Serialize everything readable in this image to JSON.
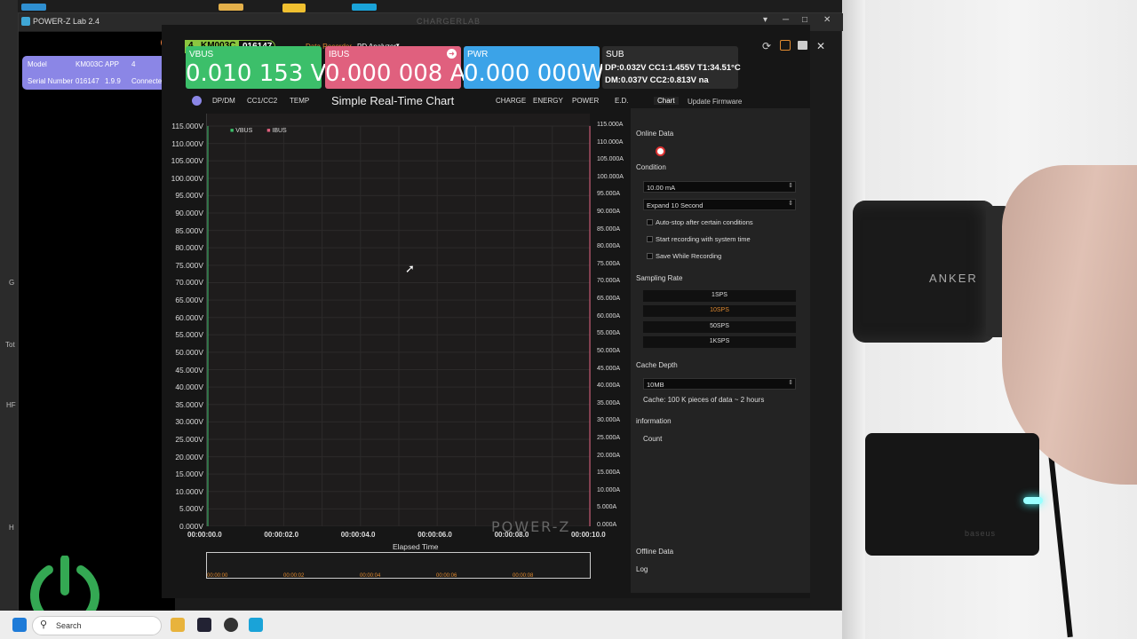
{
  "window": {
    "title": "POWER-Z Lab 2.4",
    "brand": "CHARGERLAB",
    "min": "─",
    "max": "□",
    "close": "✕",
    "restore": "▾"
  },
  "device": {
    "model_label": "Model",
    "model": "KM003C",
    "mode": "APP",
    "mode_num": "4",
    "serial_label": "Serial Number",
    "serial": "016147",
    "fw": "1.9.9",
    "status": "Connected"
  },
  "topbar": {
    "port": "4",
    "device_name": "KM003C",
    "serial": "016147",
    "data_recorder": "Data Recorder",
    "pd_analyzer": "PD Analyzer"
  },
  "meters": {
    "vbus_label": "VBUS",
    "vbus": "0.010 153 V",
    "ibus_label": "IBUS",
    "ibus": "0.000 008 A",
    "pwr_label": "PWR",
    "pwr": "0.000 000W",
    "sub_label": "SUB",
    "sub_line1": "DP:0.032V  CC1:1.455V  T1:34.51°C",
    "sub_line2": "DM:0.037V  CC2:0.813V  na",
    "colors": {
      "vbus": "#3cbf6a",
      "ibus": "#e0607e",
      "pwr": "#3ba3e8",
      "sub": "#2c2c2c"
    }
  },
  "chart_tabs": {
    "dpdm": "DP/DM",
    "cc": "CC1/CC2",
    "temp": "TEMP",
    "title": "Simple Real-Time Chart",
    "charge": "CHARGE",
    "energy": "ENERGY",
    "power": "POWER",
    "ed": "E.D."
  },
  "chart_data": {
    "type": "line",
    "title": "Simple Real-Time Chart",
    "xlabel": "Elapsed Time",
    "series": [
      {
        "name": "VBUS",
        "values": []
      },
      {
        "name": "IBUS",
        "values": []
      }
    ],
    "y_left_ticks": [
      "115.000V",
      "110.000V",
      "105.000V",
      "100.000V",
      "95.000V",
      "90.000V",
      "85.000V",
      "80.000V",
      "75.000V",
      "70.000V",
      "65.000V",
      "60.000V",
      "55.000V",
      "50.000V",
      "45.000V",
      "40.000V",
      "35.000V",
      "30.000V",
      "25.000V",
      "20.000V",
      "15.000V",
      "10.000V",
      "5.000V",
      "0.000V"
    ],
    "y_right_ticks": [
      "115.000A",
      "110.000A",
      "105.000A",
      "100.000A",
      "95.000A",
      "90.000A",
      "85.000A",
      "80.000A",
      "75.000A",
      "70.000A",
      "65.000A",
      "60.000A",
      "55.000A",
      "50.000A",
      "45.000A",
      "40.000A",
      "35.000A",
      "30.000A",
      "25.000A",
      "20.000A",
      "15.000A",
      "10.000A",
      "5.000A",
      "0.000A"
    ],
    "x_ticks": [
      "00:00:00.0",
      "00:00:02.0",
      "00:00:04.0",
      "00:00:06.0",
      "00:00:08.0",
      "00:00:10.0"
    ],
    "brush_ticks": [
      "00:00:00",
      "00:00:02",
      "00:00:04",
      "00:00:06",
      "00:00:08"
    ],
    "ylim": [
      0,
      115
    ],
    "xlim": [
      0,
      10
    ],
    "watermark": "POWER-Z",
    "grid": true,
    "legend": "top-left",
    "colors": {
      "vbus": "#3cbf6a",
      "ibus": "#e0607e"
    }
  },
  "right": {
    "tab_chart": "Chart",
    "tab_update": "Update Firmware",
    "online": "Online Data",
    "condition": "Condition",
    "cond_value": "10.00 mA",
    "expand": "Expand 10 Second",
    "opt1": "Auto-stop after certain conditions",
    "opt2": "Start recording with system time",
    "opt3": "Save While Recording",
    "sampling": "Sampling Rate",
    "rates": [
      "1SPS",
      "10SPS",
      "50SPS",
      "1KSPS"
    ],
    "cache": "Cache Depth",
    "cache_value": "10MB",
    "cache_note": "Cache: 100 K pieces of data  ~ 2 hours",
    "info": "information",
    "count": "Count",
    "offline": "Offline Data",
    "log": "Log"
  },
  "taskbar": {
    "search": "Search"
  },
  "photo": {
    "brand1": "ANKER",
    "brand2": "baseus"
  },
  "desktop": {
    "g": "G",
    "tot": "Tot",
    "hr": "HF",
    "h": "H"
  }
}
